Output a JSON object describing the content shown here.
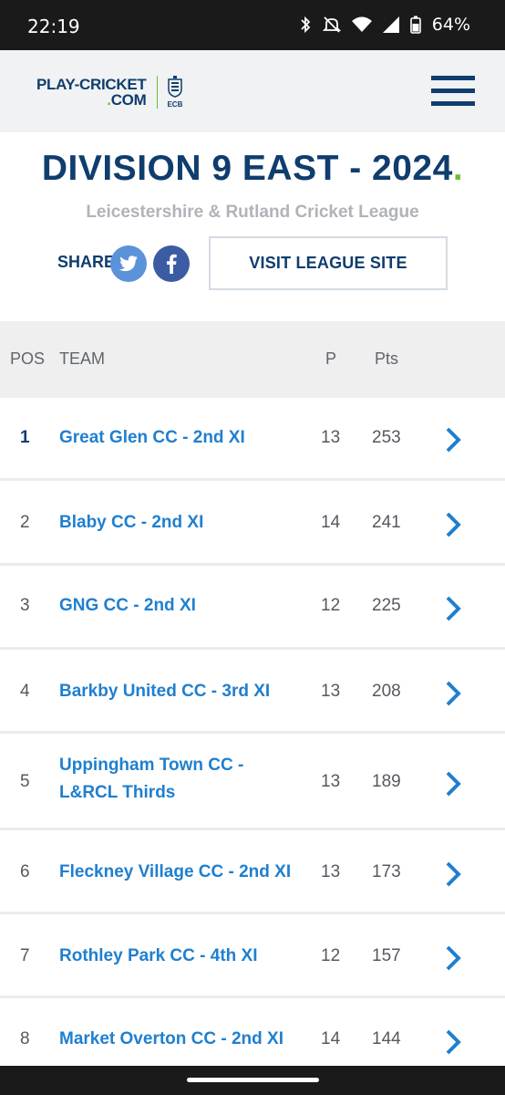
{
  "status_bar": {
    "time": "22:19",
    "battery": "64%",
    "icons": [
      "bluetooth-icon",
      "mute-icon",
      "wifi-icon",
      "signal-icon",
      "battery-icon"
    ]
  },
  "header": {
    "logo_line1": "PLAY-CRICKET",
    "logo_line2_dot": ".",
    "logo_line2": "COM",
    "ecb_label": "ECB",
    "menu_icon": "hamburger-menu-icon"
  },
  "title": {
    "main": "DIVISION 9 EAST - 2024",
    "dot": ".",
    "league": "Leicestershire & Rutland Cricket League"
  },
  "share": {
    "label": "SHARE",
    "twitter_icon": "twitter-icon",
    "facebook_icon": "facebook-icon"
  },
  "visit_button": "VISIT LEAGUE SITE",
  "table": {
    "headers": {
      "pos": "POS",
      "team": "TEAM",
      "p": "P",
      "pts": "Pts"
    },
    "rows": [
      {
        "pos": "1",
        "team": "Great Glen CC - 2nd XI",
        "p": "13",
        "pts": "253"
      },
      {
        "pos": "2",
        "team": "Blaby CC - 2nd XI",
        "p": "14",
        "pts": "241"
      },
      {
        "pos": "3",
        "team": "GNG CC - 2nd XI",
        "p": "12",
        "pts": "225"
      },
      {
        "pos": "4",
        "team": "Barkby United CC - 3rd XI",
        "p": "13",
        "pts": "208"
      },
      {
        "pos": "5",
        "team": "Uppingham Town CC - L&RCL Thirds",
        "p": "13",
        "pts": "189"
      },
      {
        "pos": "6",
        "team": "Fleckney Village CC - 2nd XI",
        "p": "13",
        "pts": "173"
      },
      {
        "pos": "7",
        "team": "Rothley Park CC - 4th XI",
        "p": "12",
        "pts": "157"
      },
      {
        "pos": "8",
        "team": "Market Overton CC - 2nd XI",
        "p": "14",
        "pts": "144"
      }
    ]
  },
  "colors": {
    "brand_navy": "#0f3d6e",
    "link_blue": "#1f7fcf",
    "accent_green": "#6bbf3a"
  }
}
